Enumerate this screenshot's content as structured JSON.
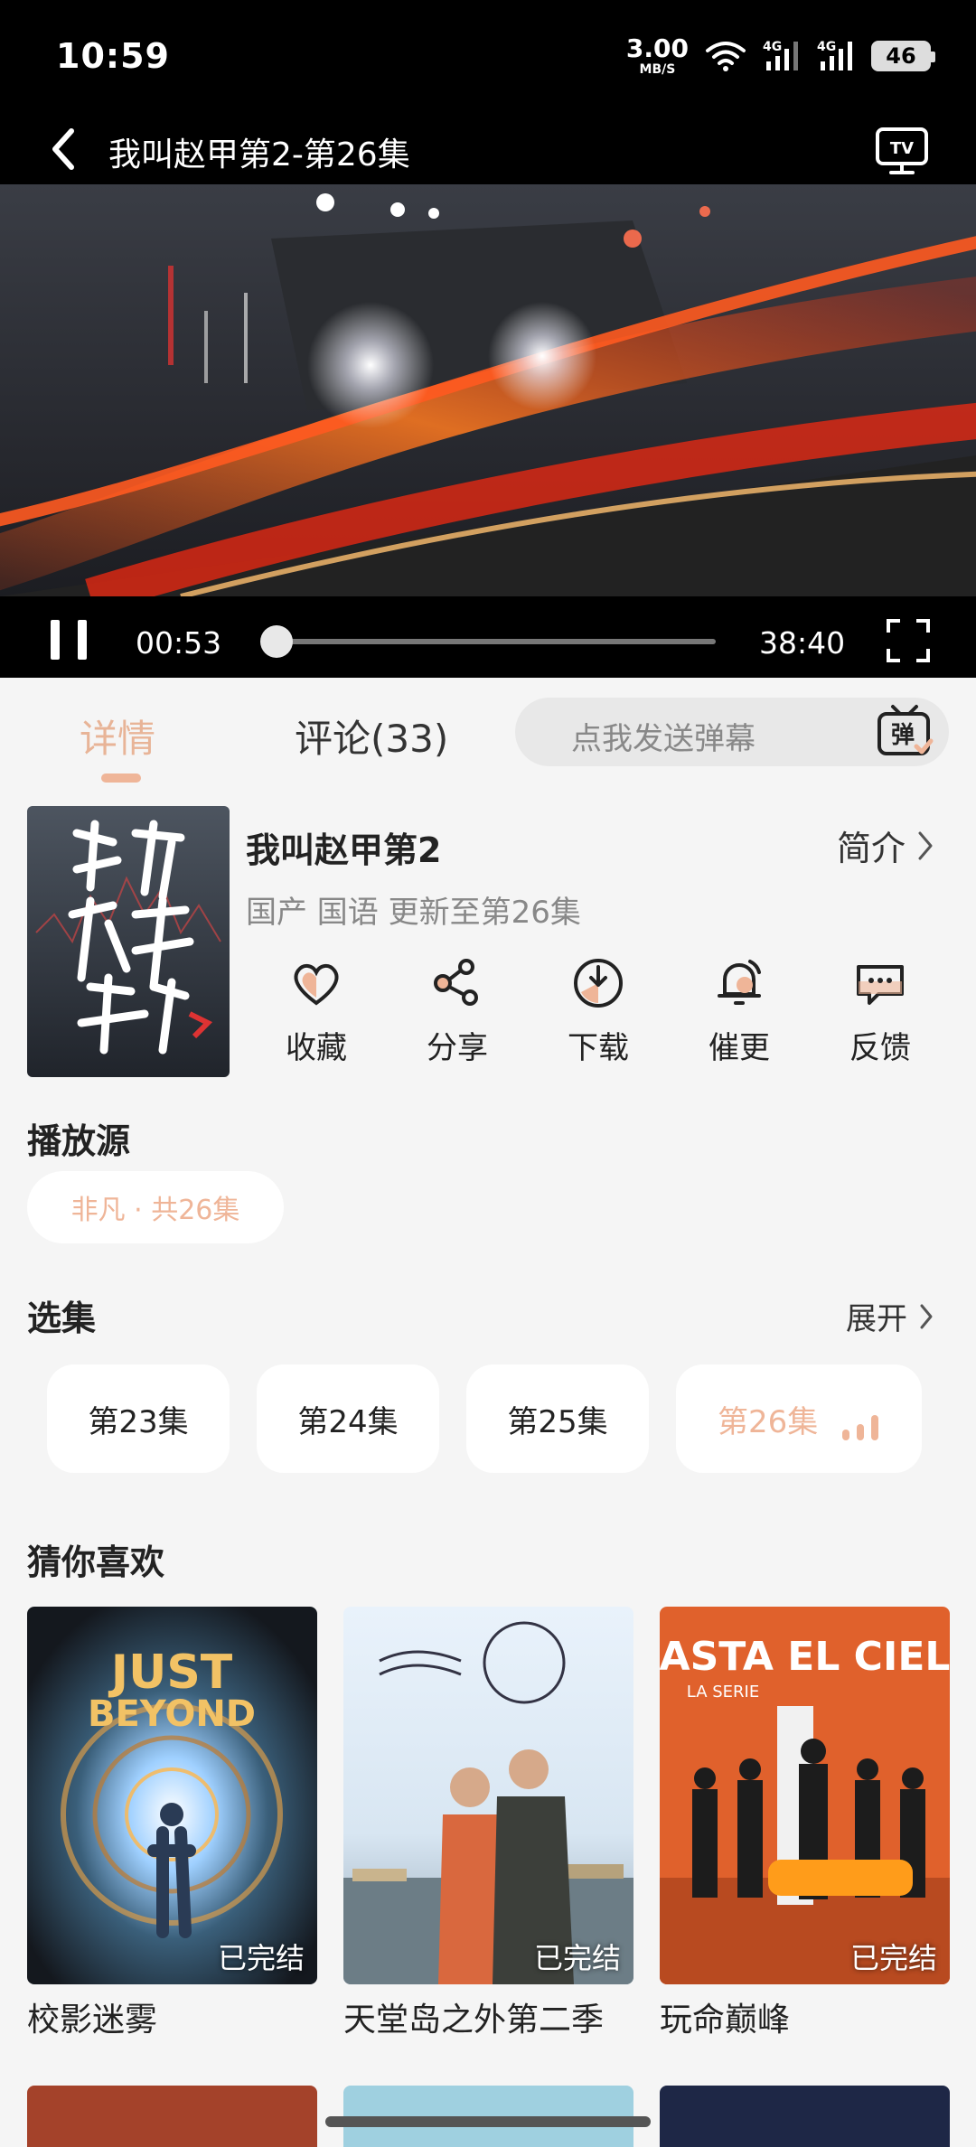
{
  "status_bar": {
    "time": "10:59",
    "net_speed": "3.00",
    "net_unit": "MB/S",
    "signal1": "4G",
    "signal2": "4G",
    "battery": "46"
  },
  "header": {
    "title": "我叫赵甲第2-第26集"
  },
  "player": {
    "current_time": "00:53",
    "total_time": "38:40",
    "progress": 0.023
  },
  "tabs": {
    "detail": "详情",
    "comments": "评论(33)"
  },
  "danmaku": {
    "placeholder": "点我发送弹幕",
    "icon_text": "弹"
  },
  "show": {
    "title": "我叫赵甲第2",
    "intro_label": "简介",
    "meta": "国产 国语 更新至第26集"
  },
  "actions": [
    {
      "label": "收藏",
      "icon": "heart-icon"
    },
    {
      "label": "分享",
      "icon": "share-icon"
    },
    {
      "label": "下载",
      "icon": "download-icon"
    },
    {
      "label": "催更",
      "icon": "bell-icon"
    },
    {
      "label": "反馈",
      "icon": "feedback-icon"
    }
  ],
  "source": {
    "title": "播放源",
    "chip": "非凡 · 共26集"
  },
  "episodes": {
    "title": "选集",
    "expand_label": "展开",
    "items": [
      "第23集",
      "第24集",
      "第25集",
      "第26集"
    ],
    "active_index": 3
  },
  "recommend": {
    "title": "猜你喜欢",
    "items": [
      {
        "title": "校影迷雾",
        "badge": "已完结"
      },
      {
        "title": "天堂岛之外第二季",
        "badge": "已完结"
      },
      {
        "title": "玩命巅峰",
        "badge": "已完结"
      }
    ]
  },
  "colors": {
    "accent": "#efb598",
    "background": "#f5f5f5",
    "header_bg": "#000000"
  }
}
